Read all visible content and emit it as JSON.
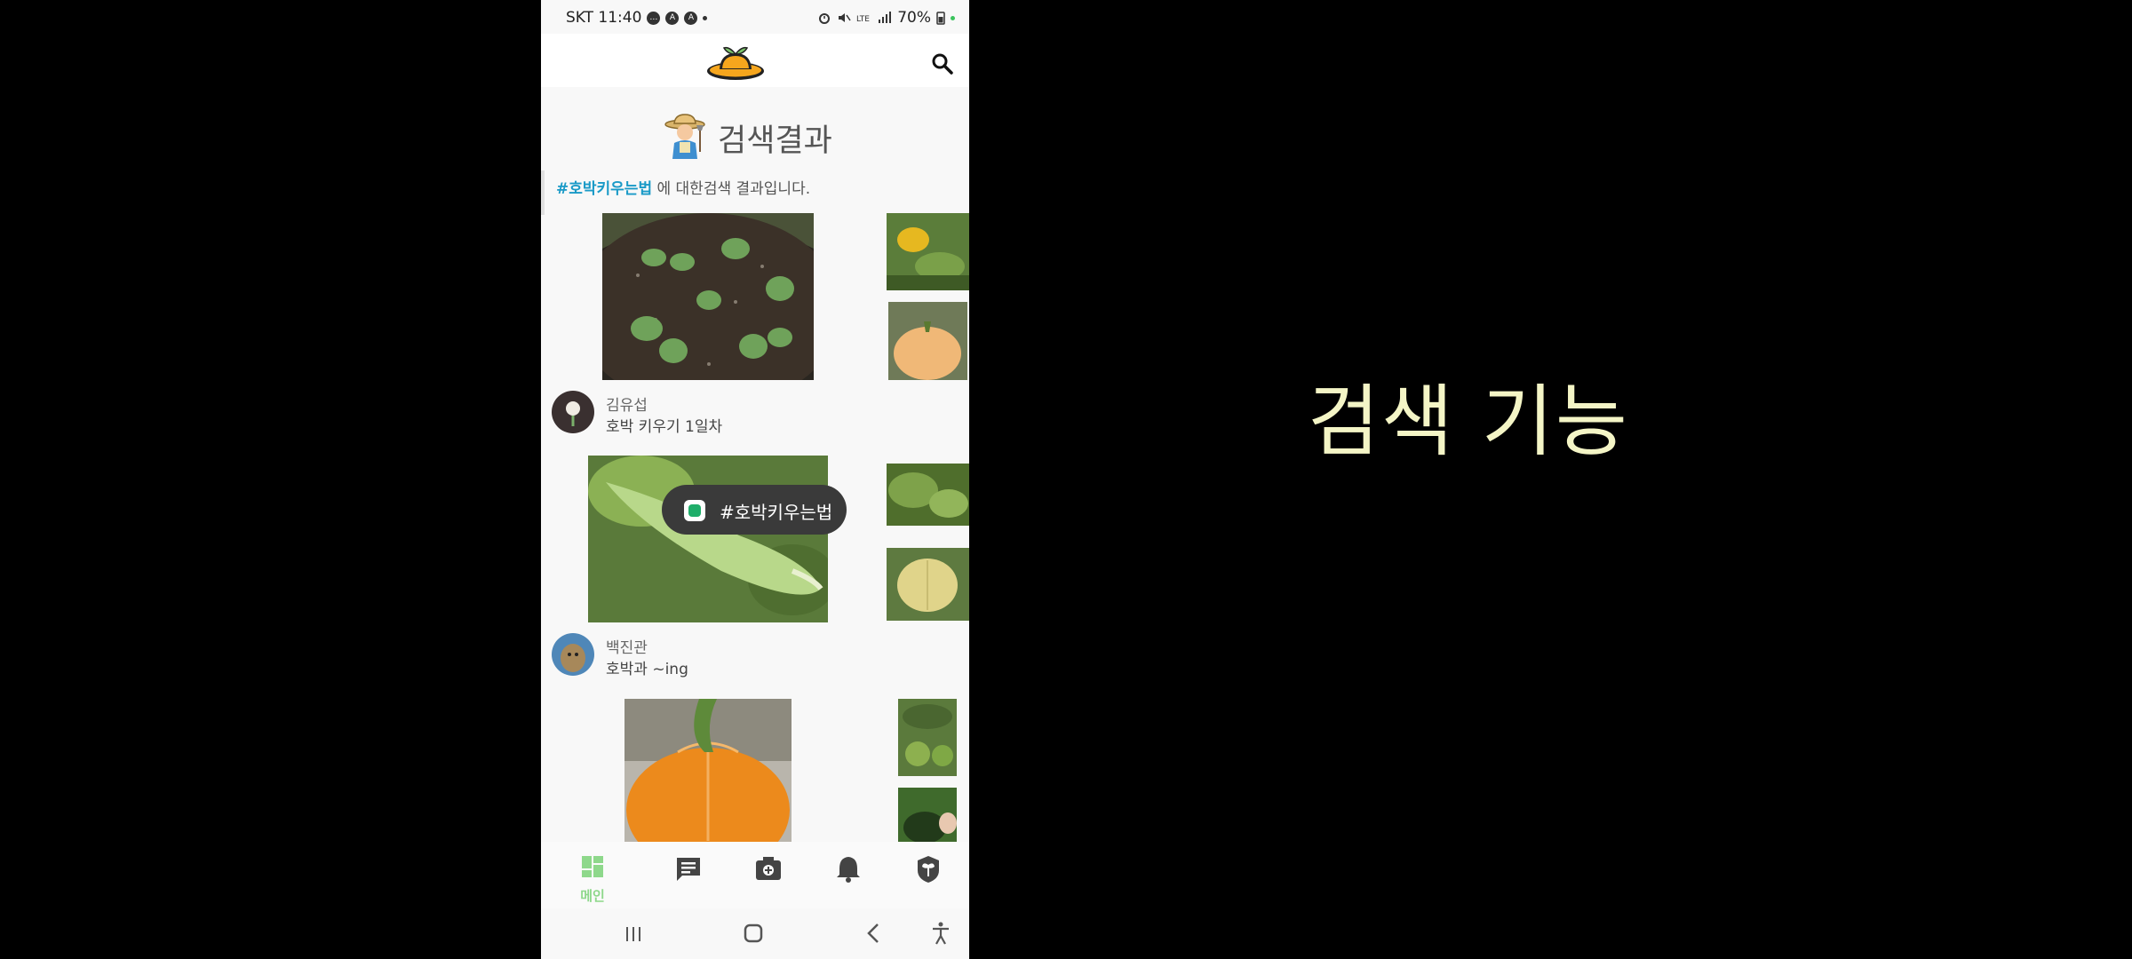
{
  "status_bar": {
    "carrier_time": "SKT 11:40",
    "battery": "70%"
  },
  "heading": {
    "title": "검색결과"
  },
  "search_result": {
    "tag": "#호박키우는법",
    "suffix": "에 대한검색 결과입니다."
  },
  "posts": [
    {
      "author": "김유섭",
      "caption": "호박 키우기 1일차"
    },
    {
      "author": "백진관",
      "caption": "호박과 ~ing"
    }
  ],
  "toast": {
    "text": "#호박키우는법"
  },
  "bottom_nav": {
    "home_label": "메인",
    "active_color": "#8ed88b"
  },
  "overlay": {
    "title": "검색 기능"
  },
  "icons": [
    "logo-icon",
    "search-icon",
    "farmer-icon",
    "home-icon",
    "chat-icon",
    "camera-icon",
    "bell-icon",
    "plant-icon",
    "recent-apps-icon",
    "home-button-icon",
    "back-icon",
    "accessibility-icon"
  ]
}
